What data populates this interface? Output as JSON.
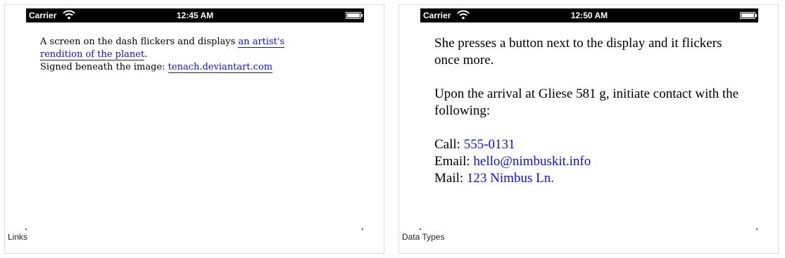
{
  "panels": [
    {
      "status_bar": {
        "carrier": "Carrier",
        "time": "12:45 AM"
      },
      "caption": "Links",
      "text": {
        "line1_prefix": "A screen on the dash flickers and displays ",
        "link1": "an artist's rendition of the planet",
        "line1_suffix": ".",
        "line2_prefix": "Signed beneath the image: ",
        "link2": "tenach.deviantart.com"
      }
    },
    {
      "status_bar": {
        "carrier": "Carrier",
        "time": "12:50 AM"
      },
      "caption": "Data Types",
      "text": {
        "para1": "She presses a button next to the display and it flickers once more.",
        "para2": "Upon the arrival at Gliese 581 g, initiate contact with the following:",
        "call_label": "Call: ",
        "call_value": "555-0131",
        "email_label": "Email: ",
        "email_value": "hello@nimbuskit.info",
        "mail_label": "Mail: ",
        "mail_value": "123 Nimbus Ln."
      }
    }
  ],
  "colors": {
    "link": "#1111cc",
    "status_bar_bg": "#000000",
    "panel_border": "#d9d9d9"
  },
  "icons": [
    "wifi-icon",
    "battery-icon"
  ]
}
